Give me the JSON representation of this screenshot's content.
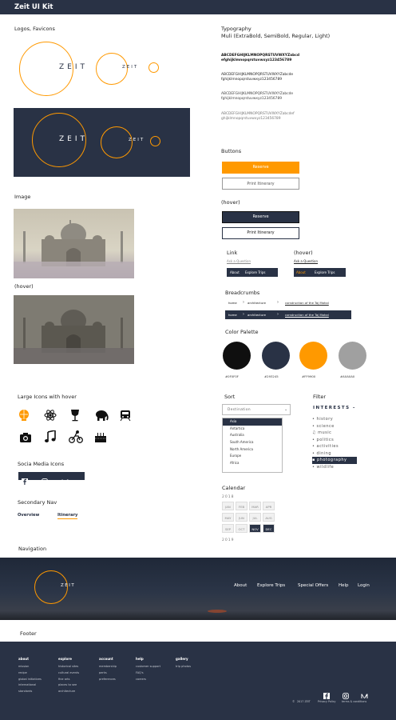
{
  "app_title": "Zeit UI Kit",
  "logos": {
    "title": "Logos, Favicons",
    "wordmark": "ZEIT"
  },
  "typography": {
    "title": "Typography",
    "subtitle": "Muli (ExtraBold, SemiBold, Regular, Light)",
    "samples": [
      {
        "line1": "ABCDEFGHIJKLMNOPQRSTUVWXYZabcd",
        "line2": "efghijklmnopqrstuvwxyz123456789"
      },
      {
        "line1": "ABCDEFGHIJKLMNOPQRSTUVWXYZabcde",
        "line2": "fghijklmnopqrstuvwxyz123456789"
      },
      {
        "line1": "ABCDEFGHIJKLMNOPQRSTUVWXYZabcde",
        "line2": "fghijklmnopqrstuvwxyz123456789"
      },
      {
        "line1": "ABCDEFGHIJKLMNOPQRSTUVWXYZabcdef",
        "line2": "ghijklmnopqrstuvwxyz123456789"
      }
    ]
  },
  "image_section": {
    "title": "Image",
    "hover_label": "(hover)"
  },
  "buttons": {
    "title": "Buttons",
    "primary": "Reserve",
    "secondary": "Print Itinerary",
    "hover_label": "(hover)",
    "primary_hover": "Reserve",
    "secondary_hover": "Print Itinerary"
  },
  "link": {
    "title": "Link",
    "hover_title": "(hover)",
    "ask": "Ask a Question",
    "ask_hover": "Ask a Question",
    "nav": [
      "About",
      "Explore Trips"
    ],
    "nav_hover": [
      "About",
      "Explore Trips"
    ]
  },
  "breadcrumbs": {
    "title": "Breadcrumbs",
    "items": [
      "home",
      "architecture",
      "construction of the Taj Mahal"
    ],
    "items_dark": [
      "home",
      "architecture",
      "construction of the Taj Mahal"
    ]
  },
  "palette": {
    "title": "Color Palette",
    "colors": [
      {
        "hex": "#0F0F0F",
        "label": "#0F0F0F"
      },
      {
        "hex": "#293245",
        "label": "#293245"
      },
      {
        "hex": "#FF9900",
        "label": "#FF9900"
      },
      {
        "hex": "#A0A0A0",
        "label": "#A0A0A0"
      }
    ]
  },
  "large_icons": {
    "title": "Large Icons with hover",
    "icons": [
      "globe-icon",
      "atom-icon",
      "wine-glass-icon",
      "elephant-icon",
      "train-icon",
      "camera-icon",
      "music-note-icon",
      "cyclist-icon",
      "cake-icon"
    ]
  },
  "social": {
    "title": "Socia Media Icons",
    "icons": [
      "facebook-icon",
      "instagram-icon",
      "medium-icon"
    ]
  },
  "secondary_nav": {
    "title": "Secondary Nav",
    "items": [
      "Overview",
      "Itinerary"
    ],
    "active": "Itinerary"
  },
  "sort": {
    "title": "Sort",
    "placeholder": "Destination",
    "options": [
      "Asia",
      "Antartica",
      "Australia",
      "South America",
      "North America",
      "Europe",
      "Africa"
    ],
    "selected": "Asia"
  },
  "filter": {
    "title": "Filter",
    "header": "INTERESTS",
    "items": [
      "history",
      "science",
      "music",
      "politics",
      "activities",
      "dining",
      "photography",
      "wildlife"
    ],
    "selected": "photography"
  },
  "calendar": {
    "title": "Calendar",
    "year1": "2018",
    "months": [
      "JAN",
      "FEB",
      "MAR",
      "APR",
      "MAY",
      "JUN",
      "JUL",
      "AUG",
      "SEP",
      "OCT",
      "NOV",
      "DEC"
    ],
    "selected": [
      "NOV",
      "DEC"
    ],
    "year2": "2019"
  },
  "navigation": {
    "title": "Navigation",
    "items": [
      "About",
      "Explore Trips",
      "Special Offers",
      "Help",
      "Login"
    ]
  },
  "footer": {
    "title": "Footer",
    "columns": [
      {
        "head": "about",
        "links": [
          "mission",
          "recipe",
          "global initiatives",
          "international",
          "standards"
        ]
      },
      {
        "head": "explore",
        "links": [
          "historical sites",
          "cultural events",
          "fine arts",
          "places to see",
          "architecture"
        ]
      },
      {
        "head": "account",
        "links": [
          "membership",
          "perks",
          "preferences"
        ]
      },
      {
        "head": "help",
        "links": [
          "customer support",
          "FAQ's",
          "careers"
        ]
      },
      {
        "head": "gallery",
        "links": [
          "trip photos"
        ]
      }
    ],
    "bottom_links": [
      "2017 ZEIT",
      "Privacy Policy",
      "terms & conditions"
    ]
  },
  "colors": {
    "navy": "#293245",
    "orange": "#FF9900",
    "black": "#0F0F0F",
    "grey": "#A0A0A0"
  }
}
